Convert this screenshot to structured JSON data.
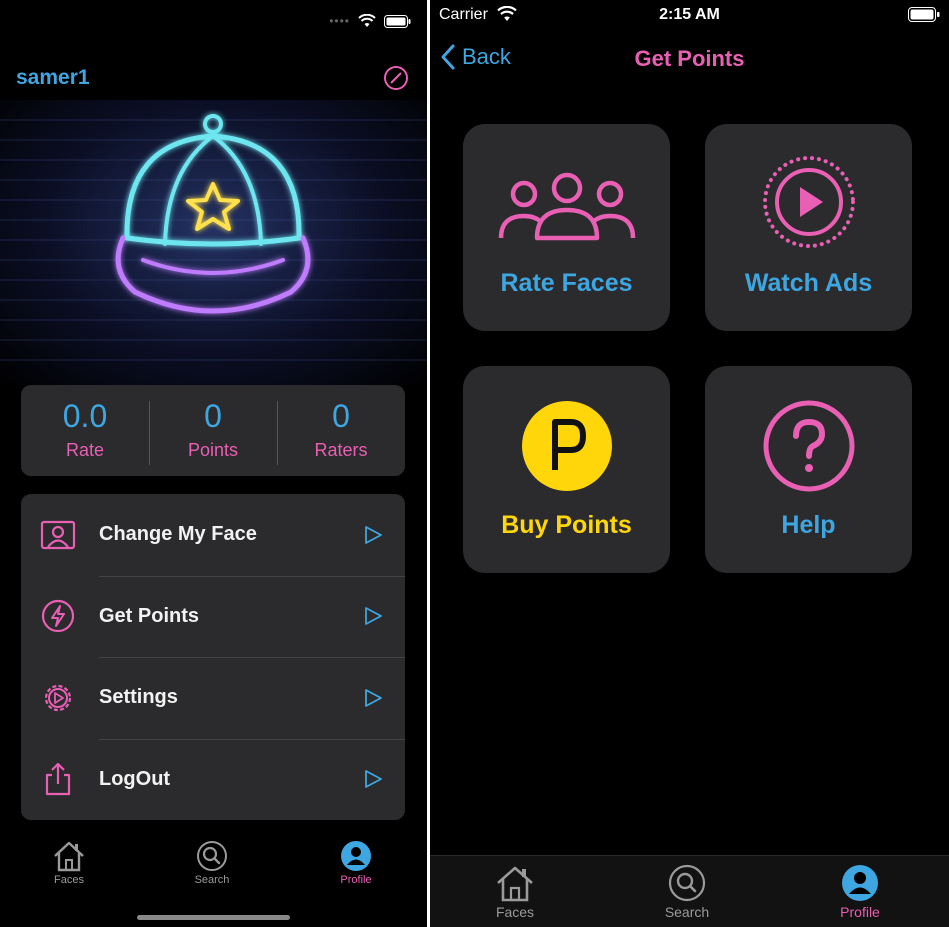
{
  "colors": {
    "accent_blue": "#3ea6e0",
    "accent_pink": "#e85fb3",
    "gold": "#ffd60a",
    "card": "#2b2b2d"
  },
  "profile_screen": {
    "username": "samer1",
    "stats": [
      {
        "value": "0.0",
        "label": "Rate"
      },
      {
        "value": "0",
        "label": "Points"
      },
      {
        "value": "0",
        "label": "Raters"
      }
    ],
    "menu": [
      {
        "label": "Change My Face",
        "icon": "portrait-icon"
      },
      {
        "label": "Get Points",
        "icon": "lightning-icon"
      },
      {
        "label": "Settings",
        "icon": "gear-icon"
      },
      {
        "label": "LogOut",
        "icon": "share-icon"
      }
    ],
    "tabs": [
      {
        "label": "Faces",
        "icon": "home-icon"
      },
      {
        "label": "Search",
        "icon": "search-icon"
      },
      {
        "label": "Profile",
        "icon": "profile-icon",
        "active": true
      }
    ]
  },
  "get_points_screen": {
    "status": {
      "carrier": "Carrier",
      "time": "2:15 AM"
    },
    "back_label": "Back",
    "title": "Get Points",
    "tiles": [
      {
        "label": "Rate Faces",
        "icon": "people-icon",
        "color": "#3ea6e0"
      },
      {
        "label": "Watch Ads",
        "icon": "play-icon",
        "color": "#3ea6e0"
      },
      {
        "label": "Buy Points",
        "icon": "points-coin-icon",
        "color": "#ffd60a"
      },
      {
        "label": "Help",
        "icon": "question-icon",
        "color": "#3ea6e0"
      }
    ],
    "tabs": [
      {
        "label": "Faces",
        "icon": "home-icon"
      },
      {
        "label": "Search",
        "icon": "search-icon"
      },
      {
        "label": "Profile",
        "icon": "profile-icon",
        "active": true
      }
    ]
  }
}
